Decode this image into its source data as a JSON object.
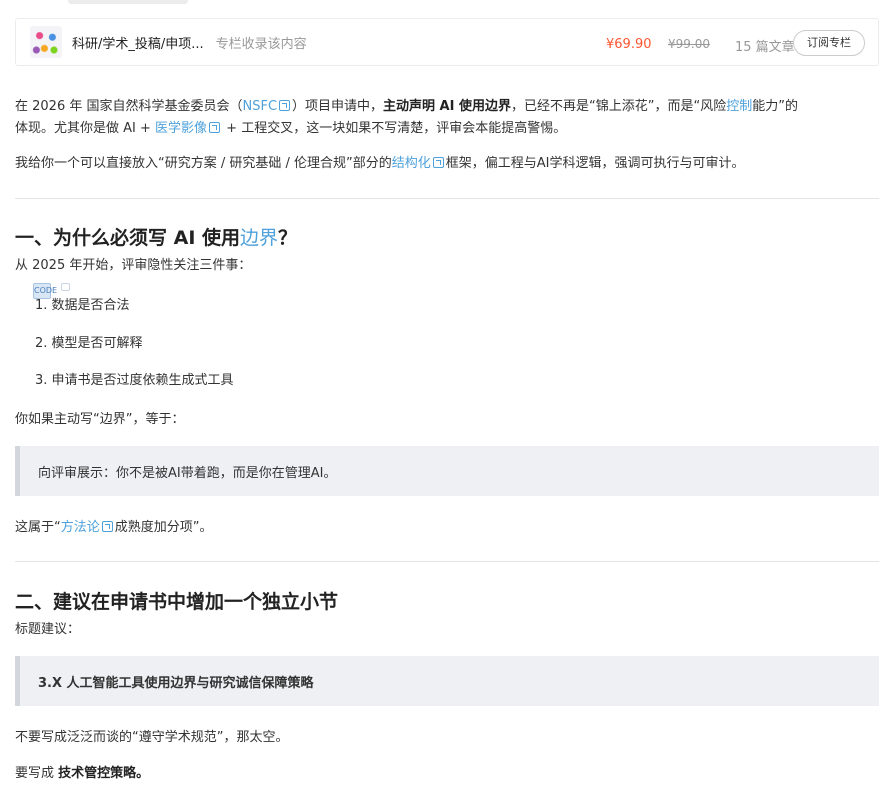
{
  "column": {
    "title": "科研/学术_投稿/申项...",
    "subtitle": "专栏收录该内容",
    "price": "¥69.90",
    "old_price": "¥99.00",
    "count": "15 篇文章",
    "subscribe_label": "订阅专栏"
  },
  "para1": {
    "t1": "在 2026 年 国家自然科学基金委员会（",
    "link_nsfc": "NSFC",
    "t2": "）项目申请中，",
    "bold": "主动声明 AI 使用边界",
    "t3": "，已经不再是“锦上添花”，而是“风险",
    "link_control": "控制",
    "t4": "能力”的",
    "line2a": "体现。尤其你是做 AI + ",
    "link_imaging": "医学影像",
    "line2b": " + 工程交叉，这一块如果不写清楚，评审会本能提高警惕。"
  },
  "para2": {
    "t1": "我给你一个可以直接放入“研究方案 / 研究基础 / 伦理合规”部分的",
    "link": "结构化",
    "t2": "框架，偏工程与AI学科逻辑，强调可执行与可审计。"
  },
  "section1": {
    "title_a": "一、为什么必须写 AI 使用",
    "title_link": "边界",
    "title_b": "？",
    "intro": "从 2025 年开始，评审隐性关注三件事：",
    "items": [
      "1. 数据是否合法",
      "2. 模型是否可解释",
      "3. 申请书是否过度依赖生成式工具"
    ],
    "after_list": "你如果主动写“边界”，等于：",
    "quote": "向评审展示：你不是被AI带着跑，而是你在管理AI。",
    "last_a": "这属于“",
    "last_link": "方法论",
    "last_b": "成熟度加分项”。"
  },
  "section2": {
    "title": "二、建议在申请书中增加一个独立小节",
    "intro": "标题建议：",
    "quote": "3.X 人工智能工具使用边界与研究诚信保障策略",
    "p1": "不要写成泛泛而谈的“遵守学术规范”，那太空。",
    "p2a": "要写成 ",
    "p2b": "技术管控策略。"
  },
  "copy_icon_label": "CODE"
}
